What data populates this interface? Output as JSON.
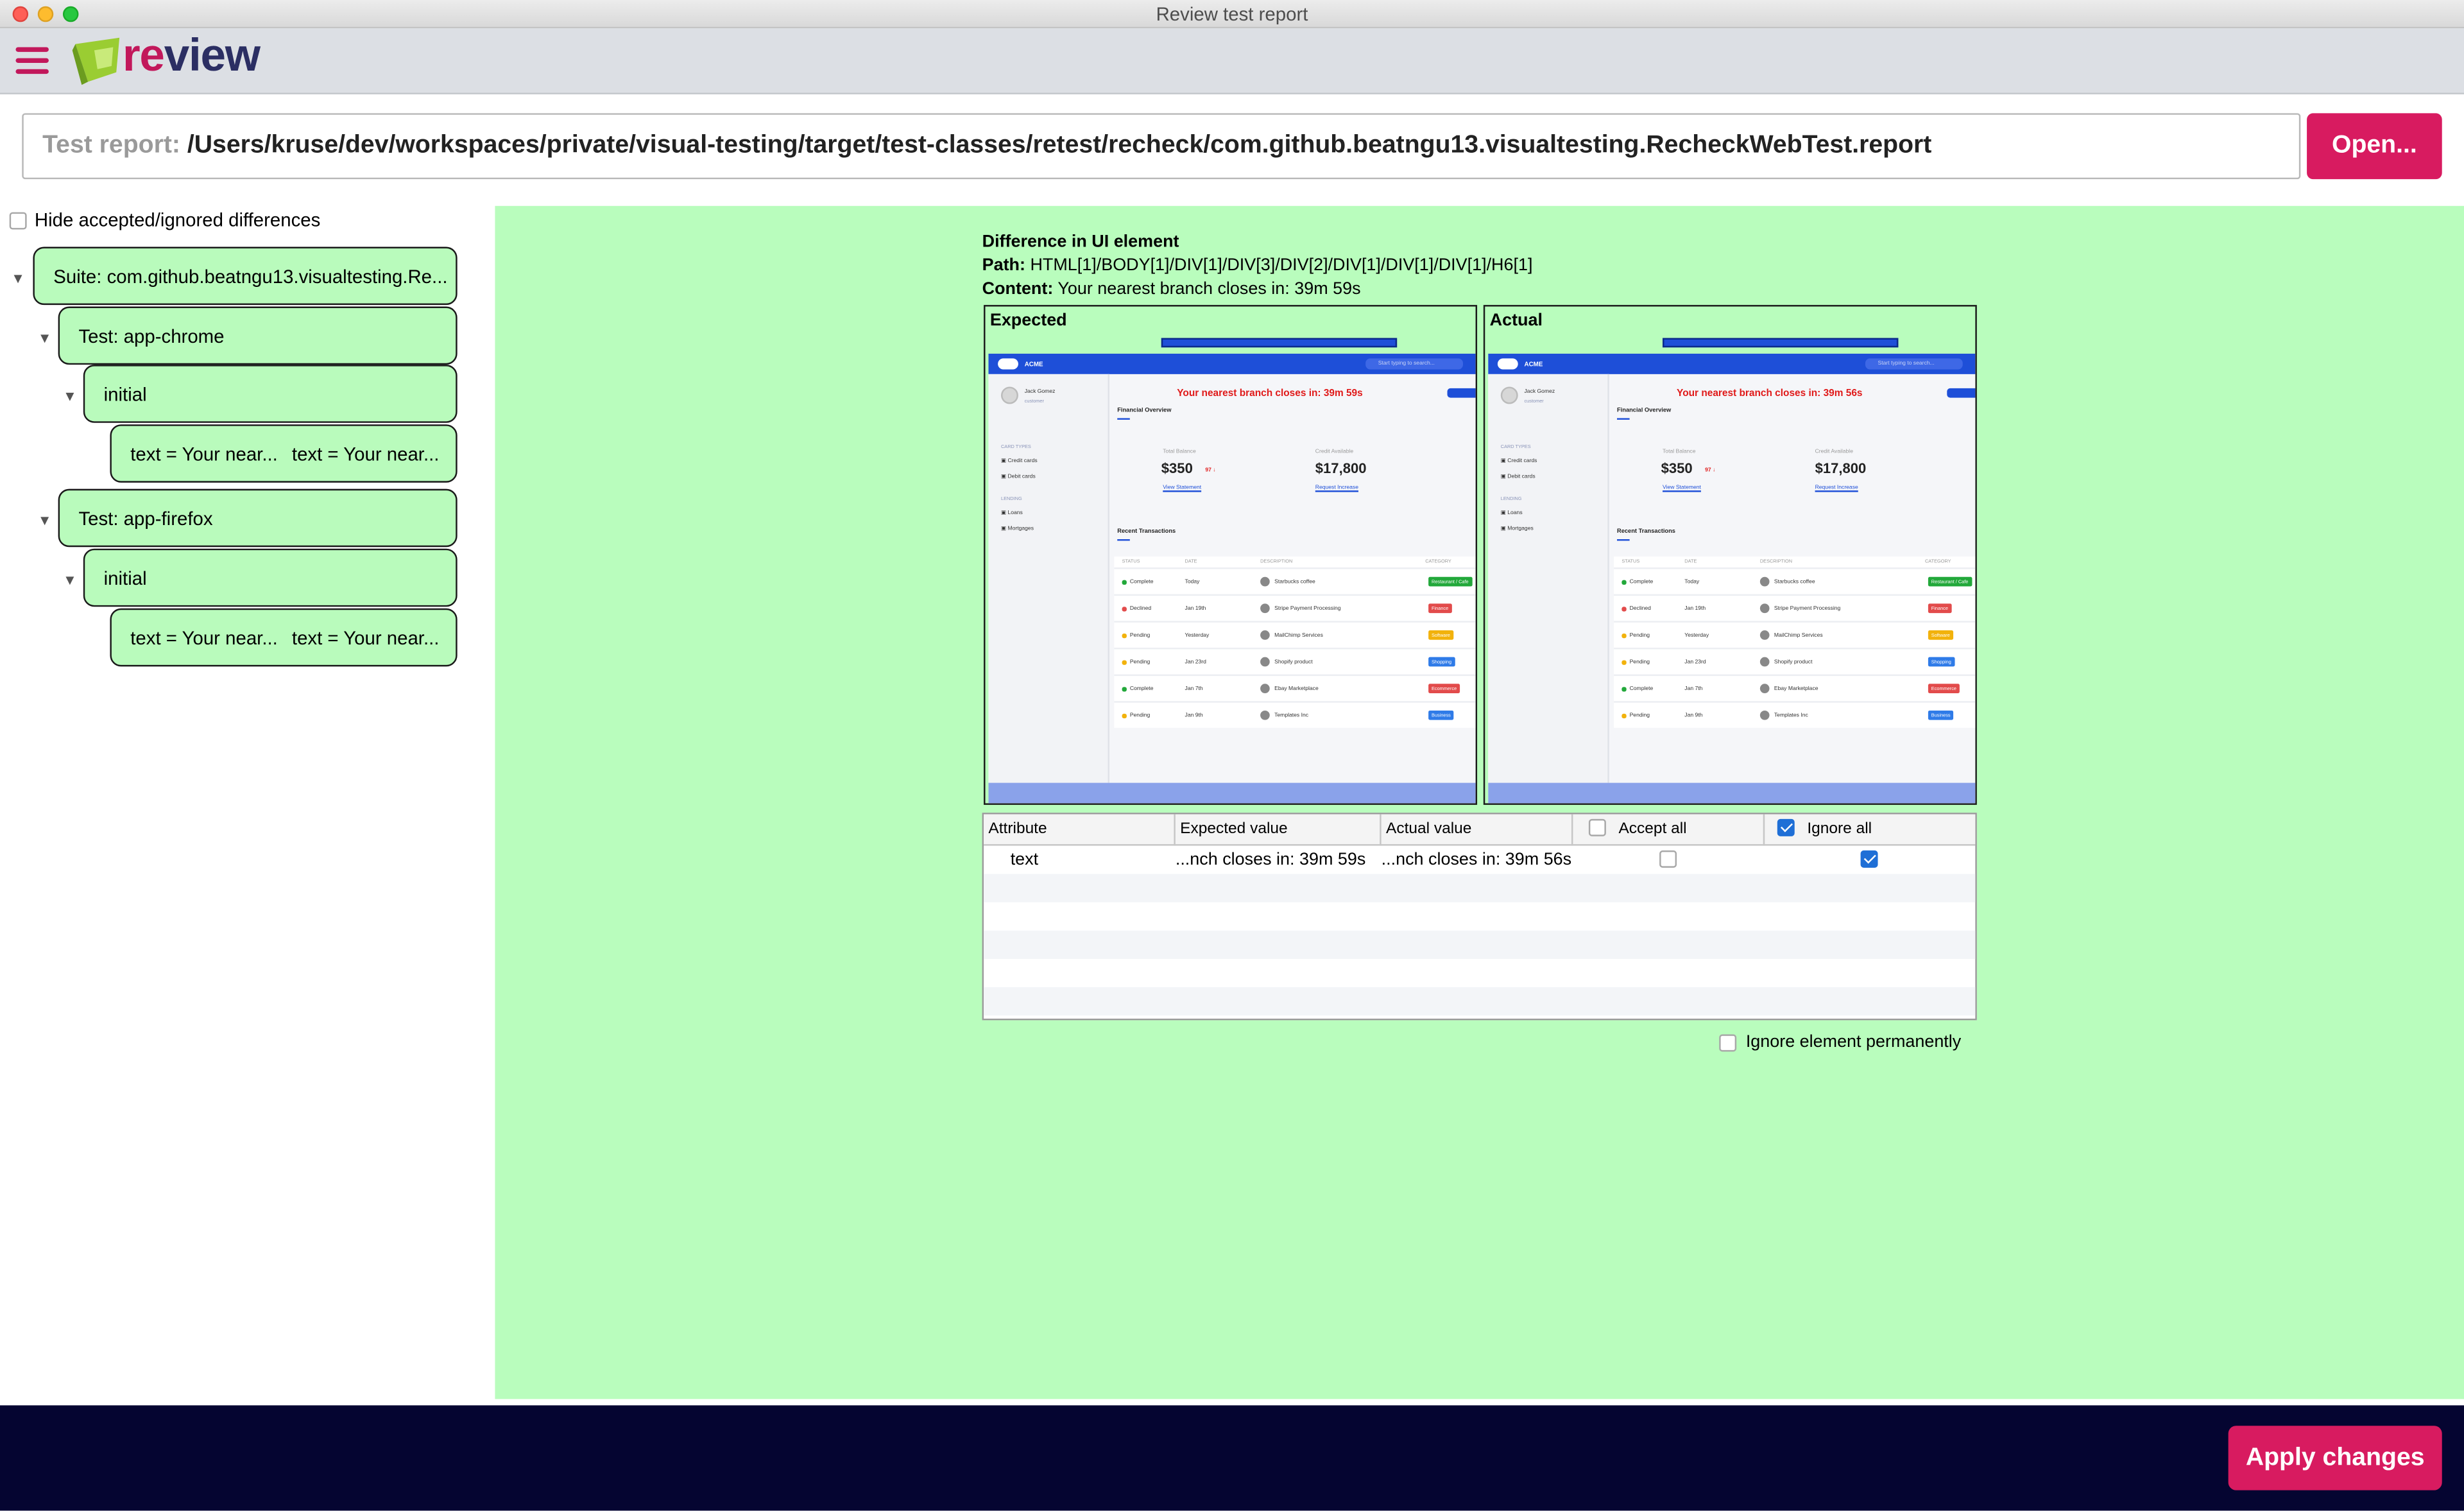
{
  "window": {
    "title": "Review test report"
  },
  "app": {
    "logo_re": "re",
    "logo_view": "view"
  },
  "report": {
    "label": "Test report:",
    "path": "/Users/kruse/dev/workspaces/private/visual-testing/target/test-classes/retest/recheck/com.github.beatngu13.visualtesting.RecheckWebTest.report",
    "open_label": "Open..."
  },
  "sidebar": {
    "hide_label": "Hide accepted/ignored differences",
    "hide_checked": false,
    "tree": {
      "suite": "Suite: com.github.beatngu13.visualtesting.Re...",
      "tests": [
        {
          "label": "Test: app-chrome",
          "step": "initial",
          "diff_a": "text = Your near...",
          "diff_b": "text = Your near..."
        },
        {
          "label": "Test: app-firefox",
          "step": "initial",
          "diff_a": "text = Your near...",
          "diff_b": "text = Your near..."
        }
      ]
    }
  },
  "difference": {
    "heading": "Difference in UI element",
    "path_label": "Path:",
    "path": "HTML[1]/BODY[1]/DIV[1]/DIV[3]/DIV[2]/DIV[1]/DIV[1]/DIV[1]/H6[1]",
    "content_label": "Content:",
    "content": "Your nearest branch closes in: 39m 59s",
    "expected_title": "Expected",
    "actual_title": "Actual"
  },
  "screenshot": {
    "brand": "ACME",
    "search": "Start typing to search...",
    "user_name": "Jack Gomez",
    "user_role": "customer",
    "card_types_label": "CARD TYPES",
    "card_items": [
      "Credit cards",
      "Debit cards"
    ],
    "loans_label": "LENDING",
    "loan_items": [
      "Loans",
      "Mortgages"
    ],
    "expected_headline": "Your nearest branch closes in: 39m 59s",
    "actual_headline": "Your nearest branch closes in: 39m 56s",
    "overview": "Financial Overview",
    "total_balance_label": "Total Balance",
    "total_balance": "$350",
    "balance_change": "97 ↓",
    "view_statement": "View Statement",
    "credit_label": "Credit Available",
    "credit": "$17,800",
    "request_increase": "Request Increase",
    "recent": "Recent Transactions",
    "columns": [
      "STATUS",
      "DATE",
      "DESCRIPTION",
      "CATEGORY"
    ],
    "rows": [
      {
        "status": "Complete",
        "date": "Today",
        "desc": "Starbucks coffee",
        "tag": "Restaurant / Cafe",
        "tag_color": "#22a83a",
        "dot": "#22a83a"
      },
      {
        "status": "Declined",
        "date": "Jan 19th",
        "desc": "Stripe Payment Processing",
        "tag": "Finance",
        "tag_color": "#e24b4b",
        "dot": "#e24b4b"
      },
      {
        "status": "Pending",
        "date": "Yesterday",
        "desc": "MailChimp Services",
        "tag": "Software",
        "tag_color": "#f2b20c",
        "dot": "#f2b20c"
      },
      {
        "status": "Pending",
        "date": "Jan 23rd",
        "desc": "Shopify product",
        "tag": "Shopping",
        "tag_color": "#2f7be8",
        "dot": "#f2b20c"
      },
      {
        "status": "Complete",
        "date": "Jan 7th",
        "desc": "Ebay Marketplace",
        "tag": "Ecommerce",
        "tag_color": "#e24b4b",
        "dot": "#22a83a"
      },
      {
        "status": "Pending",
        "date": "Jan 9th",
        "desc": "Templates Inc",
        "tag": "Business",
        "tag_color": "#2f7be8",
        "dot": "#f2b20c"
      }
    ]
  },
  "attributes": {
    "headers": [
      "Attribute",
      "Expected value",
      "Actual value",
      "Accept all",
      "Ignore all"
    ],
    "accept_all_checked": false,
    "ignore_all_checked": true,
    "rows": [
      {
        "attribute": "text",
        "expected": "...nch closes in: 39m 59s",
        "actual": "...nch closes in: 39m 56s",
        "accept": false,
        "ignore": true
      }
    ]
  },
  "ignore_permanently_label": "Ignore element permanently",
  "apply_label": "Apply changes",
  "colors": {
    "accent": "#d81b60",
    "node_bg": "#b9fbbc",
    "panel_bg": "#b9fdbd",
    "footer_bg": "#050531"
  }
}
